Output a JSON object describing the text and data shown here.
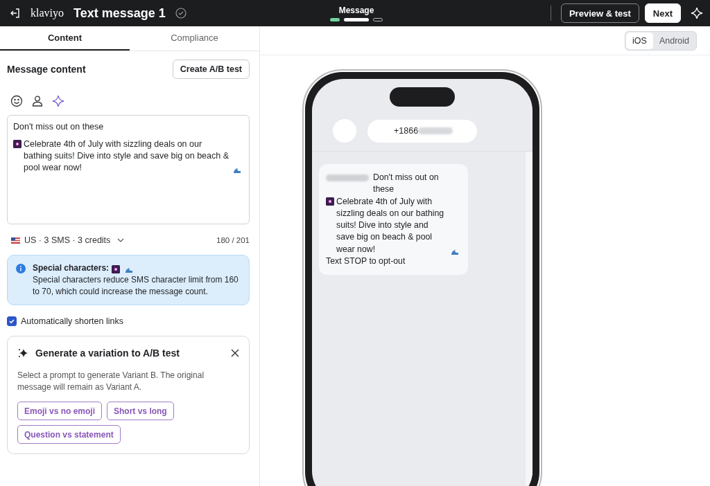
{
  "topbar": {
    "logo": "klaviyo",
    "title": "Text message 1",
    "saved": true,
    "step_label": "Message",
    "steps": [
      {
        "completed": true,
        "selected": false
      },
      {
        "completed": false,
        "selected": true
      },
      {
        "completed": false,
        "selected": false
      }
    ],
    "buttons": [
      {
        "label": "Preview & test",
        "kind": "outline"
      },
      {
        "label": "Next",
        "kind": "primary"
      }
    ]
  },
  "tabs": [
    {
      "label": "Content",
      "selected": true
    },
    {
      "label": "Compliance",
      "selected": false
    }
  ],
  "editor": {
    "heading": "Message content",
    "ab_button": "Create A/B test",
    "lines": [
      {
        "text": "Don't miss out on these",
        "emoji_before": false,
        "emoji_after": false
      },
      {
        "text": "Celebrate 4th of July with sizzling deals on our bathing suits! Dive into style and save big on beach & pool wear now!",
        "emoji_before": true,
        "emoji_after": true
      }
    ],
    "country": "US · 3 SMS · 3 credits",
    "count": "180 / 201"
  },
  "notice": {
    "title": "Special characters:",
    "body": "Special characters reduce SMS character limit from 160 to 70, which could increase the message count."
  },
  "shorten_links": {
    "label": "Automatically shorten links",
    "checked": true
  },
  "ab_card": {
    "title": "Generate a variation to A/B test",
    "description": "Select a prompt to generate Variant B. The original message will remain as Variant A.",
    "prompts": [
      "Emoji vs no emoji",
      "Short vs long",
      "Question vs statement"
    ]
  },
  "preview": {
    "platforms": [
      {
        "label": "iOS",
        "selected": true
      },
      {
        "label": "Android",
        "selected": false
      }
    ],
    "phone_number": "+1866",
    "bubble_lines": [
      "Don't miss out on these",
      "Celebrate 4th of July with sizzling deals on our bathing suits! Dive into style and save big on beach & pool wear now!",
      "Text STOP to opt-out"
    ]
  }
}
